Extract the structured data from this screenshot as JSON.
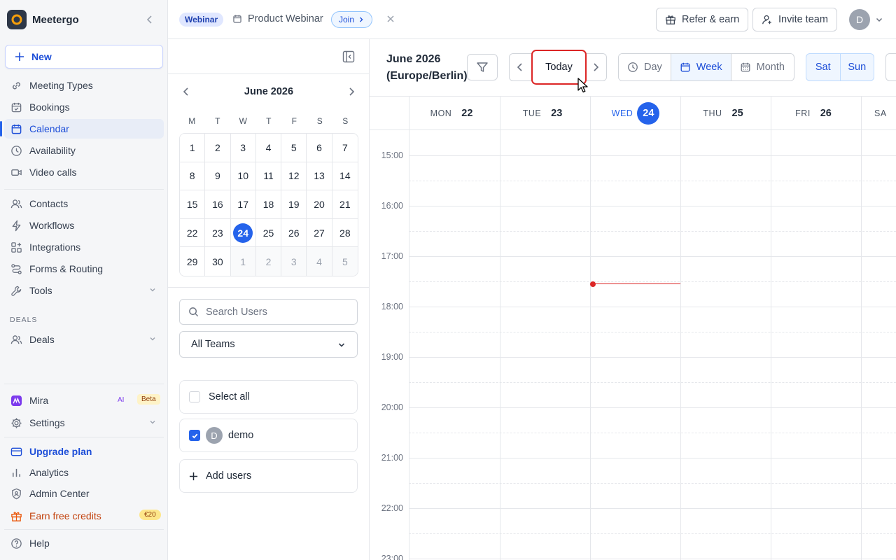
{
  "brand": {
    "name": "Meetergo"
  },
  "sidebar": {
    "new_label": "New",
    "items": [
      {
        "label": "Meeting Types",
        "icon": "link-icon"
      },
      {
        "label": "Bookings",
        "icon": "calendar-check-icon"
      },
      {
        "label": "Calendar",
        "icon": "calendar-icon",
        "active": true
      },
      {
        "label": "Availability",
        "icon": "clock-icon"
      },
      {
        "label": "Video calls",
        "icon": "video-icon"
      },
      {
        "label": "Contacts",
        "icon": "users-icon"
      },
      {
        "label": "Workflows",
        "icon": "bolt-icon"
      },
      {
        "label": "Integrations",
        "icon": "grid-icon"
      },
      {
        "label": "Forms & Routing",
        "icon": "route-icon"
      },
      {
        "label": "Tools",
        "icon": "wrench-icon"
      }
    ],
    "deals_section": "DEALS",
    "deals_label": "Deals",
    "mira_label": "Mira",
    "mira_ai": "AI",
    "mira_beta": "Beta",
    "settings_label": "Settings",
    "upgrade_label": "Upgrade plan",
    "analytics_label": "Analytics",
    "admin_label": "Admin Center",
    "earn_label": "Earn free credits",
    "earn_badge": "€20",
    "help_label": "Help"
  },
  "topbar": {
    "webinar_tag": "Webinar",
    "webinar_title": "Product Webinar",
    "join_label": "Join",
    "refer_label": "Refer & earn",
    "invite_label": "Invite team",
    "avatar_initial": "D"
  },
  "mini_calendar": {
    "title": "June 2026",
    "weekdays": [
      "M",
      "T",
      "W",
      "T",
      "F",
      "S",
      "S"
    ],
    "days": [
      "1",
      "2",
      "3",
      "4",
      "5",
      "6",
      "7",
      "8",
      "9",
      "10",
      "11",
      "12",
      "13",
      "14",
      "15",
      "16",
      "17",
      "18",
      "19",
      "20",
      "21",
      "22",
      "23",
      "24",
      "25",
      "26",
      "27",
      "28",
      "29",
      "30",
      "1",
      "2",
      "3",
      "4",
      "5"
    ]
  },
  "users_panel": {
    "search_placeholder": "Search Users",
    "teams_value": "All Teams",
    "select_all": "Select all",
    "user_initial": "D",
    "user_name": "demo",
    "add_users": "Add users"
  },
  "calendar": {
    "title_line1": "June 2026",
    "title_line2": "(Europe/Berlin)",
    "today_label": "Today",
    "view_day": "Day",
    "view_week": "Week",
    "view_month": "Month",
    "toggle_sat": "Sat",
    "toggle_sun": "Sun",
    "columns": [
      {
        "name": "MON",
        "date": "22"
      },
      {
        "name": "TUE",
        "date": "23"
      },
      {
        "name": "WED",
        "date": "24",
        "today": true
      },
      {
        "name": "THU",
        "date": "25"
      },
      {
        "name": "FRI",
        "date": "26"
      },
      {
        "name": "SA",
        "date": ""
      }
    ],
    "times": [
      "15:00",
      "16:00",
      "17:00",
      "18:00",
      "19:00",
      "20:00",
      "21:00",
      "22:00",
      "23:00"
    ]
  },
  "colors": {
    "accent": "#2563eb",
    "now_line": "#dc2626",
    "highlight": "#dc2626"
  }
}
